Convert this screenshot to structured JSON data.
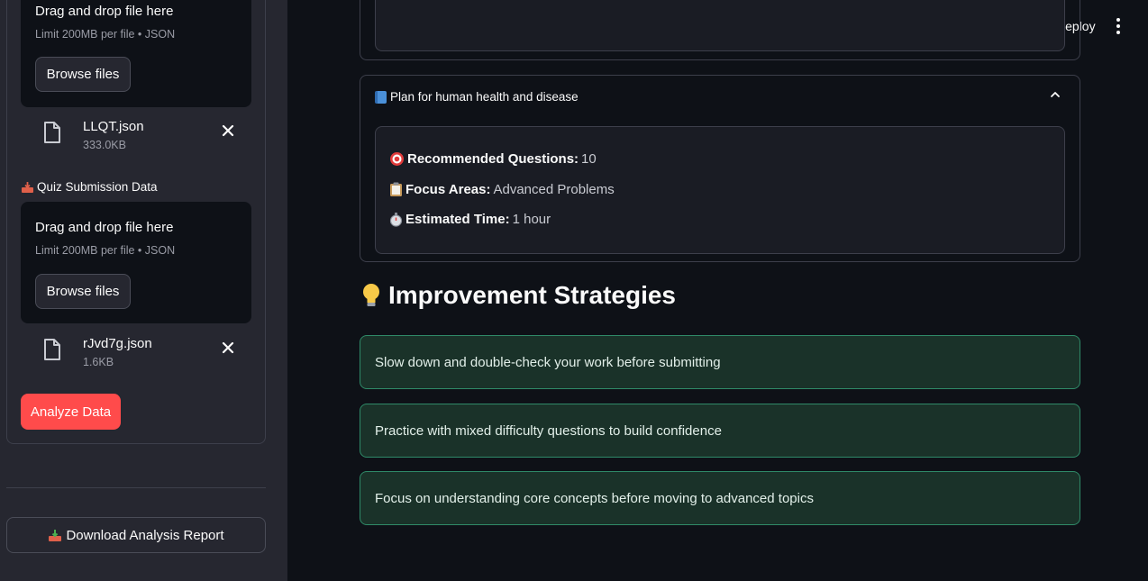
{
  "header": {
    "deploy_label": "Deploy"
  },
  "sidebar": {
    "upload1": {
      "drop_text": "Drag and drop file here",
      "limit_text": "Limit 200MB per file • JSON",
      "browse_label": "Browse files",
      "file": {
        "name": "LLQT.json",
        "size": "333.0KB"
      }
    },
    "section_label": "Quiz Submission Data",
    "upload2": {
      "drop_text": "Drag and drop file here",
      "limit_text": "Limit 200MB per file • JSON",
      "browse_label": "Browse files",
      "file": {
        "name": "rJvd7g.json",
        "size": "1.6KB"
      }
    },
    "analyze_label": "Analyze Data",
    "download_label": "Download Analysis Report"
  },
  "main": {
    "expander": {
      "title": "Plan for human health and disease",
      "lines": [
        {
          "label": "Recommended Questions:",
          "value": "10"
        },
        {
          "label": "Focus Areas:",
          "value": "Advanced Problems"
        },
        {
          "label": "Estimated Time:",
          "value": "1 hour"
        }
      ]
    },
    "strategies_heading": "Improvement Strategies",
    "strategies": [
      "Slow down and double-check your work before submitting",
      "Practice with mixed difficulty questions to build confidence",
      "Focus on understanding core concepts before moving to advanced topics"
    ]
  },
  "colors": {
    "accent": "#ff4b4b",
    "background": "#0e1117",
    "sidebar": "#262730",
    "success_bg": "#1a3229",
    "success_border": "#2f8a68"
  }
}
